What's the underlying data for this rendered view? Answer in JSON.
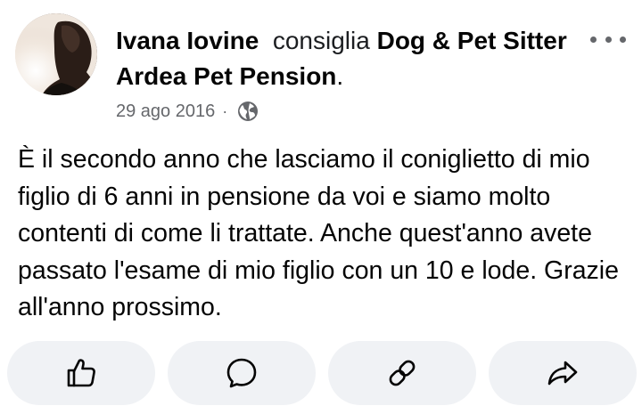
{
  "post": {
    "author": "Ivana Iovine",
    "verb": "consiglia",
    "page": "Dog & Pet Sitter Ardea Pet Pension",
    "punctuation": ".",
    "date": "29 ago 2016",
    "separator": "·",
    "privacy_icon": "globe-icon",
    "body": "È  il secondo anno che lasciamo il coniglietto di mio figlio di 6 anni  in pensione da voi e siamo molto contenti di come li trattate. Anche quest'anno avete passato l'esame di mio figlio con un 10 e lode. Grazie all'anno prossimo."
  },
  "actions": [
    {
      "icon": "thumbs-up-icon"
    },
    {
      "icon": "comment-icon"
    },
    {
      "icon": "link-icon"
    },
    {
      "icon": "share-icon"
    }
  ],
  "colors": {
    "text": "#050505",
    "secondary": "#65676b",
    "button_bg": "#f0f2f5"
  }
}
